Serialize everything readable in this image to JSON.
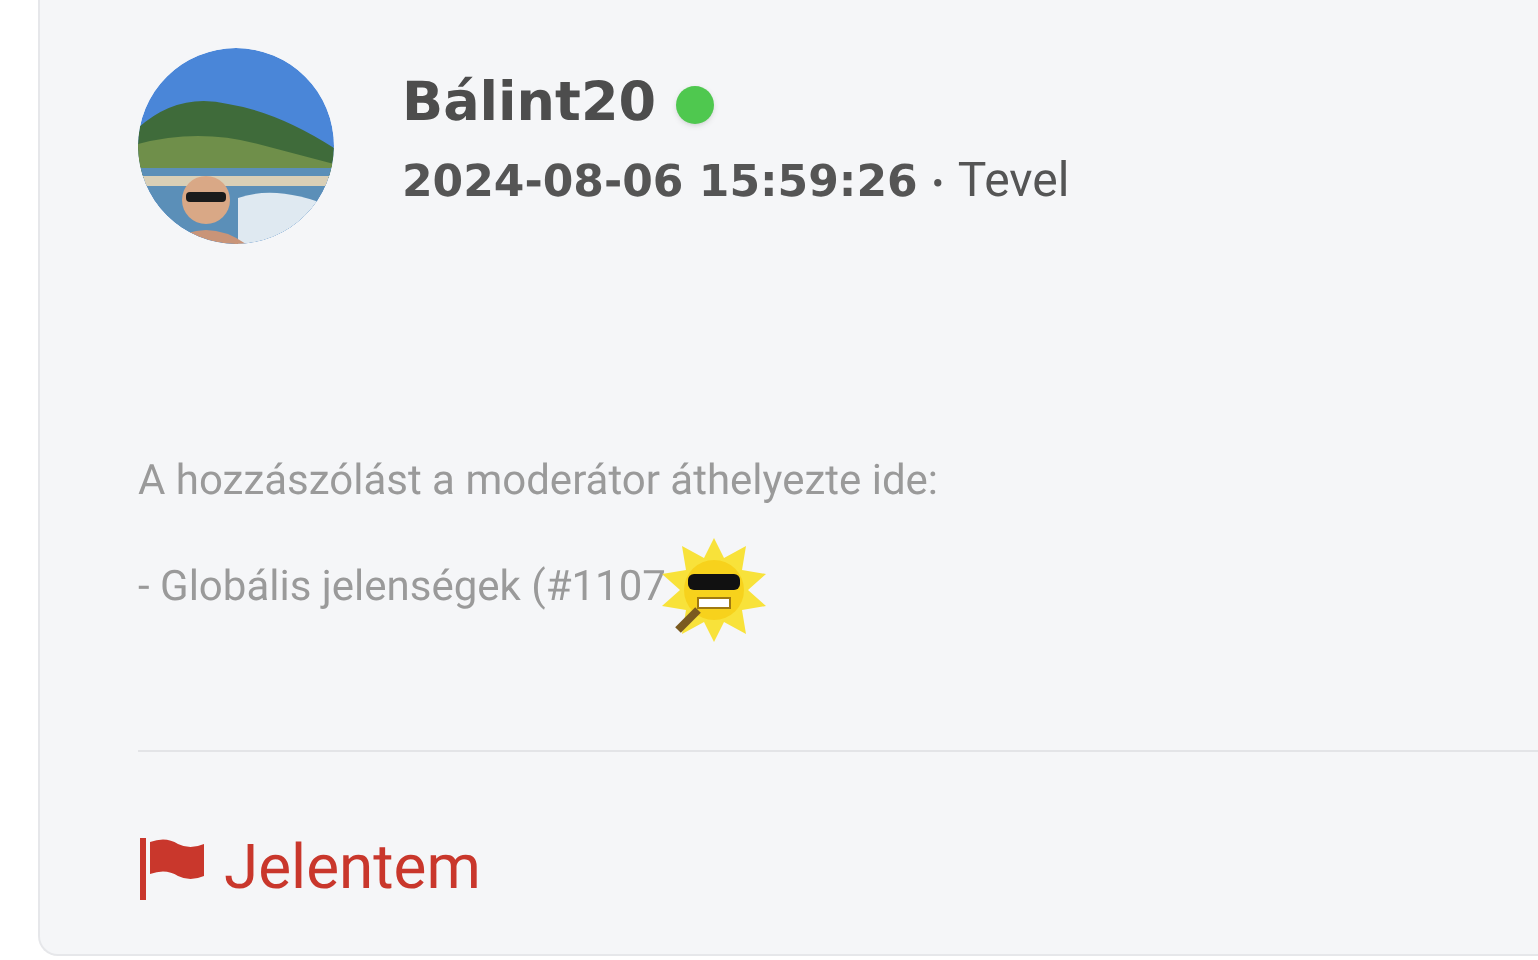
{
  "post": {
    "author": "Bálint20",
    "online": true,
    "timestamp": "2024-08-06 15:59:26",
    "location": "Tevel",
    "separator": "•",
    "body": [
      "A hozzászólást a moderátor áthelyezte ide:",
      "- Globális jelenségek (#1107"
    ],
    "report_link": "Jelentem"
  }
}
